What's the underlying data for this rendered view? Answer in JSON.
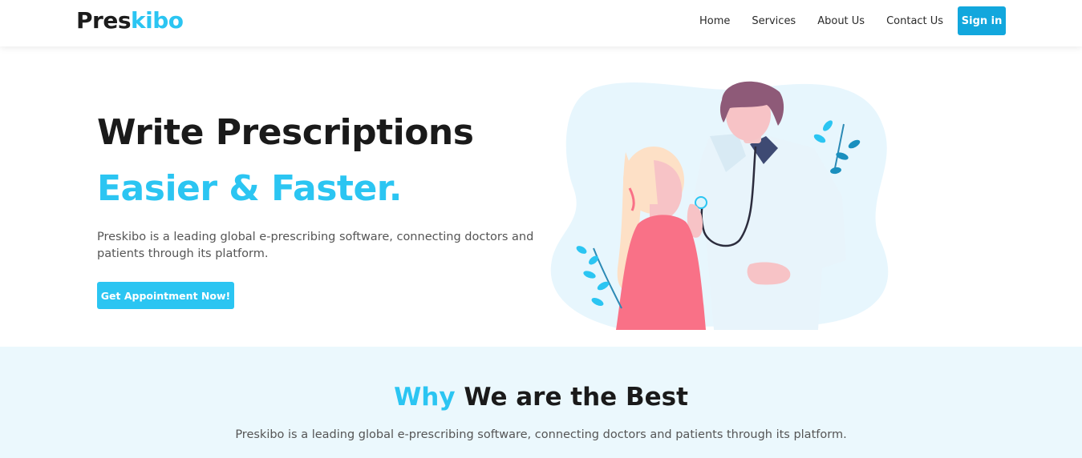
{
  "header": {
    "logo_part1": "Pres",
    "logo_part2": "kibo",
    "nav": [
      "Home",
      "Services",
      "About Us",
      "Contact Us"
    ],
    "signin_label": "Sign in"
  },
  "hero": {
    "title": "Write Prescriptions",
    "subtitle": "Easier & Faster.",
    "description": "Preskibo is a leading global e-prescribing software, connecting doctors and patients through its platform.",
    "cta_label": "Get Appointment Now!"
  },
  "why": {
    "title_accent": "Why",
    "title_rest": "We are the Best",
    "description": "Preskibo is a leading global e-prescribing software, connecting doctors and patients through its platform."
  },
  "colors": {
    "accent": "#2bc5f2",
    "signin": "#12a7dd",
    "section_bg": "#ebf8fd",
    "patient_shirt": "#f97187",
    "doctor_hair": "#8e5a78"
  },
  "icons": [
    "doctor-illustration",
    "leaf-icon"
  ]
}
